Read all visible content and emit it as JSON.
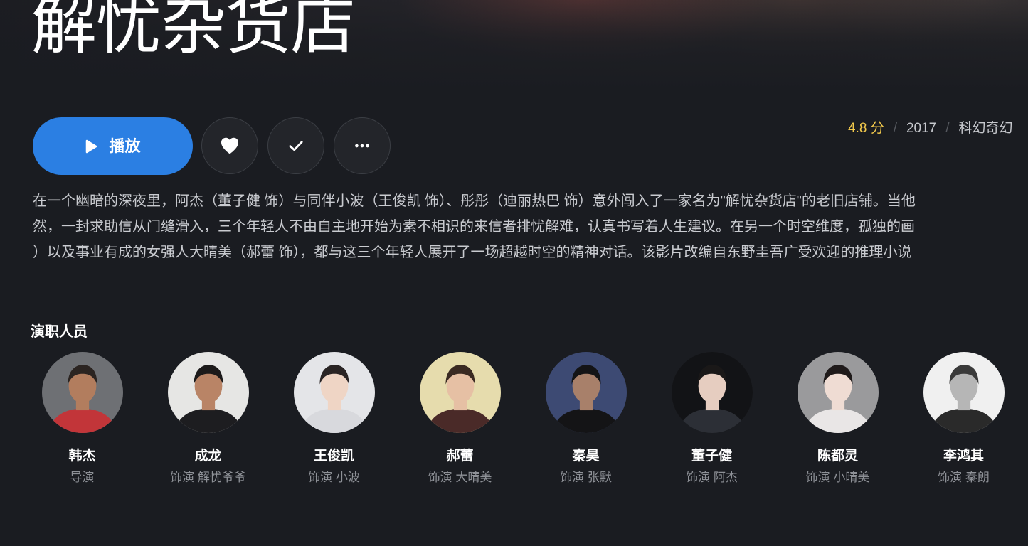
{
  "title": "解忧杂货店",
  "actions": {
    "play": {
      "label": "播放",
      "icon": "play-icon"
    },
    "favorite": {
      "icon": "heart-icon"
    },
    "mark_watched": {
      "icon": "check-icon"
    },
    "more": {
      "icon": "more-icon"
    }
  },
  "meta": {
    "rating": "4.8 分",
    "separator": "/",
    "year": "2017",
    "genre": "科幻奇幻"
  },
  "description_lines": [
    "在一个幽暗的深夜里，阿杰（董子健 饰）与同伴小波（王俊凯 饰）、彤彤（迪丽热巴 饰）意外闯入了一家名为\"解忧杂货店\"的老旧店铺。当他",
    "然，一封求助信从门缝滑入，三个年轻人不由自主地开始为素不相识的来信者排忧解难，认真书写着人生建议。在另一个时空维度，孤独的画",
    "）以及事业有成的女强人大晴美（郝蕾 饰），都与这三个年轻人展开了一场超越时空的精神对话。该影片改编自东野圭吾广受欢迎的推理小说"
  ],
  "cast": {
    "heading": "演职人员",
    "members": [
      {
        "name": "韩杰",
        "role": "导演",
        "avatar": {
          "bg": "#6e7074",
          "skin": "#b27d5e",
          "hair": "#2b2421",
          "cloth": "#c23539"
        }
      },
      {
        "name": "成龙",
        "role": "饰演 解忧爷爷",
        "avatar": {
          "bg": "#e6e6e4",
          "skin": "#b98466",
          "hair": "#1c1a1a",
          "cloth": "#1d1d20"
        }
      },
      {
        "name": "王俊凯",
        "role": "饰演 小波",
        "avatar": {
          "bg": "#e4e5e8",
          "skin": "#efd5c5",
          "hair": "#2a2424",
          "cloth": "#d8d9dd"
        }
      },
      {
        "name": "郝蕾",
        "role": "饰演 大晴美",
        "avatar": {
          "bg": "#e6dcad",
          "skin": "#e6c0a4",
          "hair": "#3a2a22",
          "cloth": "#4a2a28"
        }
      },
      {
        "name": "秦昊",
        "role": "饰演 张默",
        "avatar": {
          "bg": "#3d4a73",
          "skin": "#a8806a",
          "hair": "#141416",
          "cloth": "#141416"
        }
      },
      {
        "name": "董子健",
        "role": "饰演 阿杰",
        "avatar": {
          "bg": "#121316",
          "skin": "#e6cdc0",
          "hair": "#1a1818",
          "cloth": "#2c2f36"
        }
      },
      {
        "name": "陈都灵",
        "role": "饰演 小晴美",
        "avatar": {
          "bg": "#9a9a9c",
          "skin": "#efdcd3",
          "hair": "#1f1a1a",
          "cloth": "#e9e6e6"
        }
      },
      {
        "name": "李鸿其",
        "role": "饰演 秦朗",
        "avatar": {
          "bg": "#f0f0f0",
          "skin": "#b6b6b6",
          "hair": "#3a3a3a",
          "cloth": "#2a2a2a"
        }
      }
    ]
  },
  "colors": {
    "background": "#1a1c21",
    "accent": "#2b7fe3",
    "rating": "#f2c94c",
    "text_secondary": "#8e9197"
  }
}
